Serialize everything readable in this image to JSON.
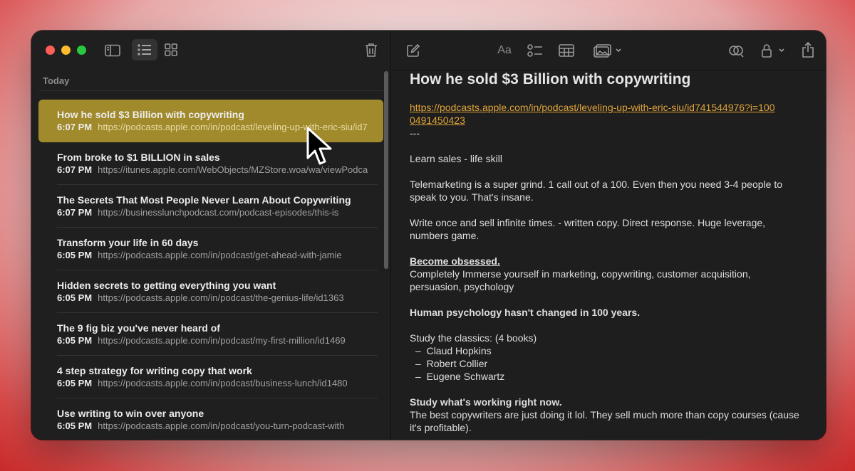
{
  "window": {
    "section_header": "Today",
    "toolbar_icons": [
      "sidebar-icon",
      "list-view-icon",
      "gallery-view-icon",
      "trash-icon",
      "compose-icon",
      "format-text-icon",
      "checklist-icon",
      "table-icon",
      "media-icon",
      "collaborate-icon",
      "lock-icon",
      "share-icon",
      "search-icon"
    ],
    "format_label": "Aa"
  },
  "notes": [
    {
      "title": "How he sold $3 Billion with copywriting",
      "time": "6:07 PM",
      "snippet": "https://podcasts.apple.com/in/podcast/leveling-up-with-eric-siu/id741544976?i=1000491450423",
      "selected": true
    },
    {
      "title": "From broke to $1 BILLION in sales",
      "time": "6:07 PM",
      "snippet": "https://itunes.apple.com/WebObjects/MZStore.woa/wa/viewPodcast"
    },
    {
      "title": "The Secrets That Most People Never Learn About Copywriting",
      "time": "6:07 PM",
      "snippet": "https://businesslunchpodcast.com/podcast-episodes/this-is"
    },
    {
      "title": "Transform your life in 60 days",
      "time": "6:05 PM",
      "snippet": "https://podcasts.apple.com/in/podcast/get-ahead-with-jamie"
    },
    {
      "title": "Hidden secrets to getting everything you want",
      "time": "6:05 PM",
      "snippet": "https://podcasts.apple.com/in/podcast/the-genius-life/id1363"
    },
    {
      "title": "The 9 fig biz you've never heard of",
      "time": "6:05 PM",
      "snippet": "https://podcasts.apple.com/in/podcast/my-first-million/id1469"
    },
    {
      "title": "4 step strategy for writing copy that work",
      "time": "6:05 PM",
      "snippet": "https://podcasts.apple.com/in/podcast/business-lunch/id1480"
    },
    {
      "title": "Use writing to win over anyone",
      "time": "6:05 PM",
      "snippet": "https://podcasts.apple.com/in/podcast/you-turn-podcast-with"
    }
  ],
  "document": {
    "title": "How he sold $3 Billion with copywriting",
    "link": "https://podcasts.apple.com/in/podcast/leveling-up-with-eric-siu/id741544976?i=1000491450423",
    "dashes": "---",
    "p1": "Learn sales - life skill",
    "p2": "Telemarketing is a super grind. 1 call out of a 100. Even then you need 3-4 people to speak to you. That's insane.",
    "p3": "Write once and sell infinite times. - written copy. Direct response. Huge leverage, numbers game.",
    "h1": "Become obsessed.",
    "p4": "Completely Immerse yourself in marketing, copywriting, customer acquisition, persuasion, psychology",
    "h2": "Human psychology hasn't changed in 100 years.",
    "p5": "Study the classics: (4 books)",
    "books": [
      "Claud Hopkins",
      "Robert Collier",
      "Eugene Schwartz"
    ],
    "h3": "Study what's working right now.",
    "p6": "The best copywriters are just doing it lol. They sell much more than copy courses (cause it's profitable)."
  }
}
